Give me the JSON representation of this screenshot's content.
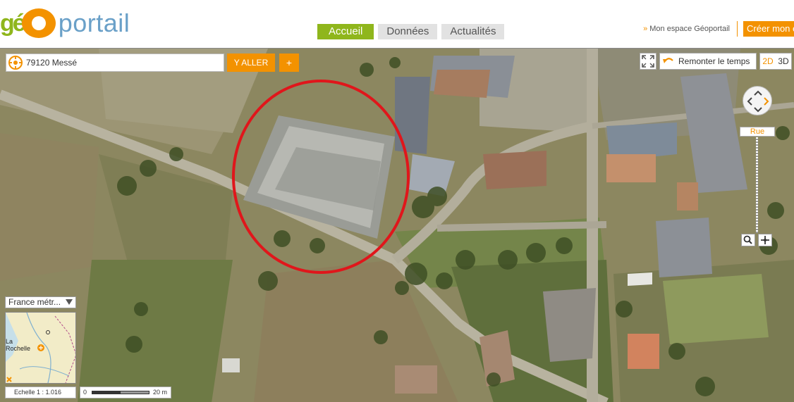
{
  "header": {
    "logo": {
      "part1": "g",
      "part2": "é",
      "part3": "portail"
    },
    "tabs": [
      {
        "label": "Accueil",
        "active": true
      },
      {
        "label": "Données",
        "active": false
      },
      {
        "label": "Actualités",
        "active": false
      }
    ],
    "mon_espace": "Mon espace Géoportail",
    "creer": "Créer mon e"
  },
  "search": {
    "value": "79120 Messé",
    "go_label": "Y ALLER",
    "plus_label": "+"
  },
  "toolbar": {
    "remonter_label": "Remonter le temps",
    "mode_2d": "2D",
    "mode_3d": "3D"
  },
  "zoom": {
    "level_label": "Rue",
    "level_fraction": 0.45
  },
  "territory": {
    "value": "France métr..."
  },
  "minimap": {
    "city": "La\nRochelle"
  },
  "scale": {
    "echelle": "Echelle 1 :  1.016",
    "start": "0",
    "end": "20 m"
  },
  "colors": {
    "accent_orange": "#f39200",
    "accent_green": "#8fb61c",
    "logo_blue": "#6aa0c8",
    "annotation_red": "#e0161b"
  }
}
